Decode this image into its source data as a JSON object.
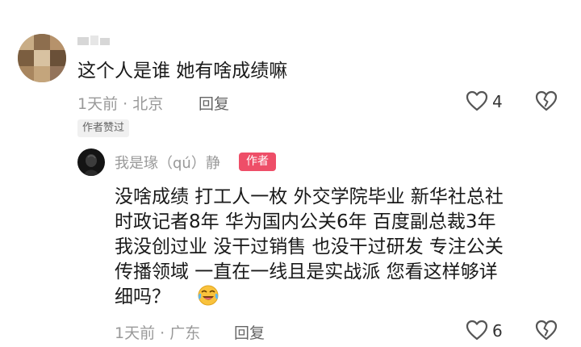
{
  "comment": {
    "text": "这个人是谁 她有啥成绩嘛",
    "time_location": "1天前 · 北京",
    "reply_label": "回复",
    "like_count": "4",
    "badge": "作者赞过"
  },
  "reply": {
    "author": "我是瑑（qú）静",
    "author_badge": "作者",
    "lines": [
      "没啥成绩 打工人一枚 外交学院毕业 新华社总社",
      "时政记者8年 华为国内公关6年 百度副总裁3年",
      "我没创过业 没干过销售 也没干过研发 专注公关",
      "传播领域 一直在一线且是实战派 您看这样够详",
      "细吗？"
    ],
    "time_location": "1天前 · 广东",
    "reply_label": "回复",
    "like_count": "6"
  },
  "colors": {
    "author_badge": "#ee4e68",
    "meta_text": "#999999",
    "icon_stroke": "#555555"
  },
  "icons": [
    "heart-icon",
    "broken-heart-icon",
    "laughing-crying-emoji"
  ]
}
